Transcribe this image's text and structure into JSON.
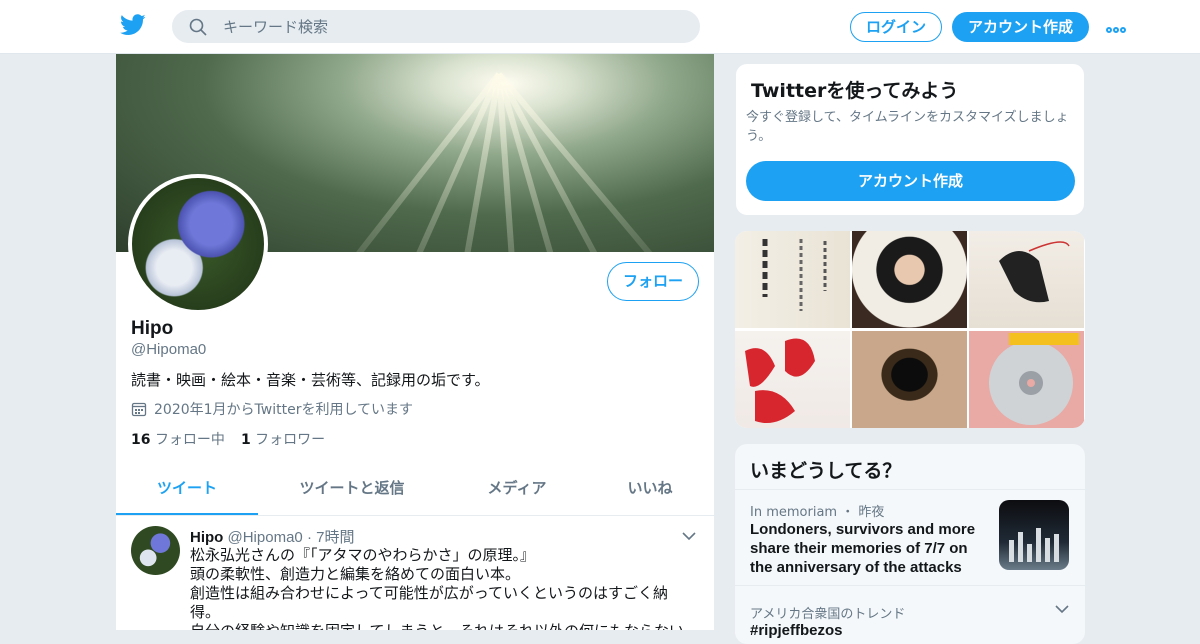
{
  "search": {
    "placeholder": "キーワード検索"
  },
  "header": {
    "login_label": "ログイン",
    "signup_label": "アカウント作成"
  },
  "profile": {
    "follow_label": "フォロー",
    "name": "Hipo",
    "handle": "@Hipoma0",
    "bio": "読書・映画・絵本・音楽・芸術等、記録用の垢です。",
    "joined": "2020年1月からTwitterを利用しています",
    "following_count": "16",
    "following_label": "フォロー中",
    "followers_count": "1",
    "followers_label": "フォロワー"
  },
  "tabs": [
    "ツイート",
    "ツイートと返信",
    "メディア",
    "いいね"
  ],
  "tweet": {
    "name": "Hipo",
    "handle": "@Hipoma0",
    "time": "7時間",
    "lines": [
      "松永弘光さんの『「アタマのやわらかさ」の原理。』",
      "頭の柔軟性、創造力と編集を絡めての面白い本。",
      "創造性は組み合わせによって可能性が広がっていくというのはすごく納得。",
      "自分の経験や知識を固定してしまうと、それはそれ以外の何にもならない"
    ]
  },
  "signup_card": {
    "title": "Twitterを使ってみよう",
    "desc": "今すぐ登録して、タイムラインをカスタマイズしましょう。",
    "button": "アカウント作成"
  },
  "trends": {
    "title": "いまどうしてる？",
    "item1_meta": "In memoriam ・ 昨夜",
    "item1_title": "Londoners, survivors and more share their memories of 7/7 on the anniversary of the attacks",
    "item2_meta": "アメリカ合衆国のトレンド",
    "item2_tag": "#ripjeffbezos"
  },
  "colors": {
    "accent": "#1da1f2",
    "muted": "#657786",
    "background": "#e6ecf0"
  }
}
